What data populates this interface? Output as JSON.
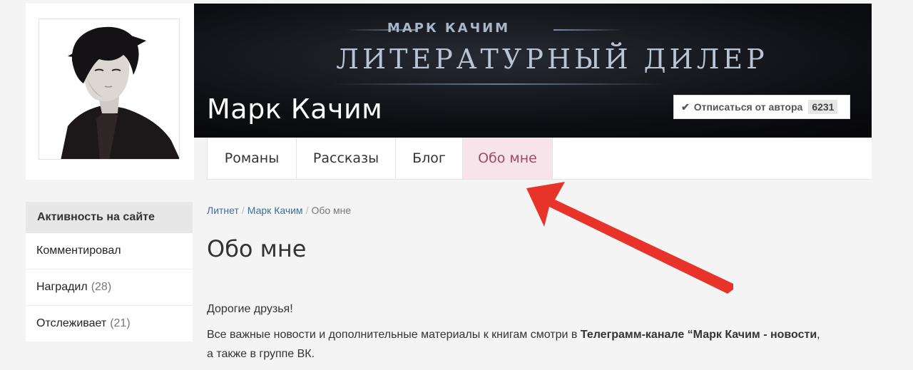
{
  "banner": {
    "top_text": "МАРК КАЧИМ",
    "main_text": "ЛИТЕРАТУРНЫЙ ДИЛЕР"
  },
  "author": {
    "name": "Марк Качим"
  },
  "subscribe": {
    "label": "Отписаться от автора",
    "count": "6231",
    "icon": "check-icon"
  },
  "tabs": [
    {
      "label": "Романы",
      "active": false
    },
    {
      "label": "Рассказы",
      "active": false
    },
    {
      "label": "Блог",
      "active": false
    },
    {
      "label": "Обо мне",
      "active": true
    }
  ],
  "sidebar": {
    "title": "Активность на сайте",
    "items": [
      {
        "label": "Комментировал",
        "count": ""
      },
      {
        "label": "Наградил",
        "count": "(28)"
      },
      {
        "label": "Отслеживает",
        "count": "(21)"
      }
    ]
  },
  "breadcrumb": {
    "items": [
      "Литнет",
      "Марк Качим",
      "Обо мне"
    ],
    "separator": "/"
  },
  "page": {
    "title": "Обо мне",
    "greeting": "Дорогие друзья!",
    "text_before": "Все важные новости и дополнительные материалы к книгам смотри в ",
    "text_bold": "Телеграмм-канале “Марк Качим - новости",
    "text_after": ",",
    "text_line2": "а также в группе ВК."
  },
  "colors": {
    "active_tab_bg": "#f7e4ea",
    "active_tab_text": "#9b4b69",
    "link": "#3a6f9e",
    "arrow": "#e8332a"
  }
}
